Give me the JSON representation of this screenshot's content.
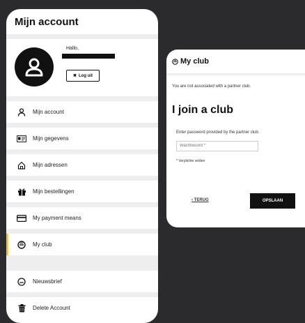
{
  "account": {
    "title": "Mijn account",
    "greeting": "Hallo,",
    "logout_label": "Log uit"
  },
  "menu": {
    "items": [
      {
        "label": "Mijn account",
        "icon": "user-icon"
      },
      {
        "label": "Mijn gegevens",
        "icon": "id-card-icon"
      },
      {
        "label": "Mijn adressen",
        "icon": "home-icon"
      },
      {
        "label": "Mijn bestellingen",
        "icon": "gift-icon"
      },
      {
        "label": "My payment means",
        "icon": "credit-card-icon"
      },
      {
        "label": "My club",
        "icon": "club-icon",
        "active": true
      },
      {
        "label": "Nieuwsbrief",
        "icon": "newsletter-icon"
      },
      {
        "label": "Delete Account",
        "icon": "trash-icon"
      }
    ]
  },
  "club": {
    "header": "My club",
    "not_associated": "You are not associated with a partner club.",
    "join_title": "I join a club",
    "password_label": "Enter password provided by the partner club.",
    "password_placeholder": "Wachtwoord *",
    "required_note": "* Verplichte velden",
    "back_label": "‹ TERUG",
    "save_label": "OPSLAAN"
  },
  "colors": {
    "active_accent": "#f2c832",
    "button_dark": "#111111",
    "background": "#2b2b2d"
  }
}
